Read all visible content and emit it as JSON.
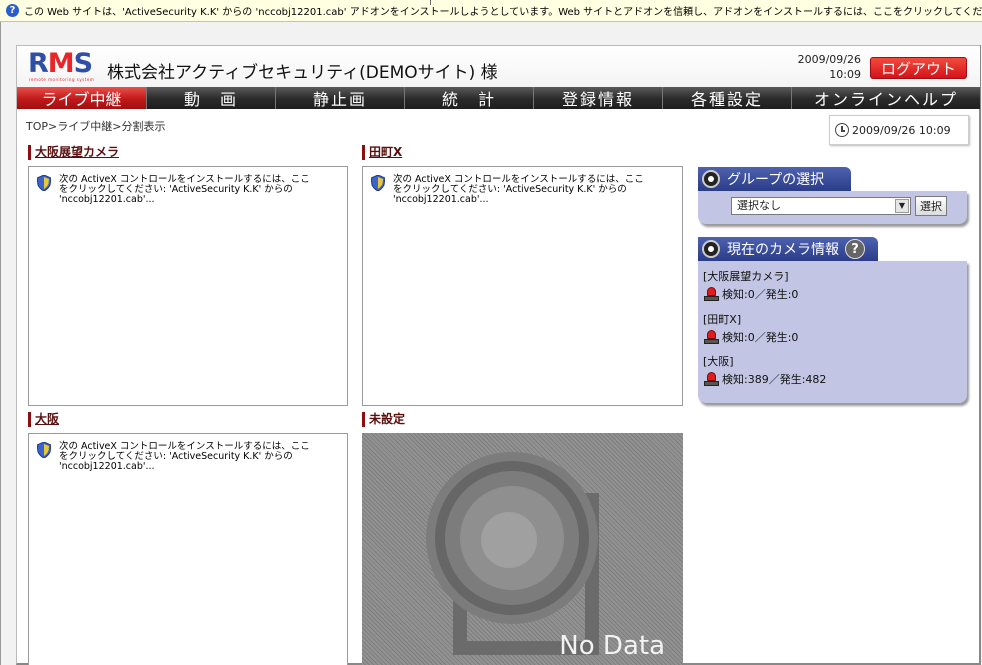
{
  "infobar": {
    "text": "この Web サイトは、'ActiveSecurity K.K' からの 'nccobj12201.cab' アドオンをインストールしようとしています。Web サイトとアドオンを信頼し、アドオンをインストールするには、ここをクリックしてください..."
  },
  "header": {
    "logo": "RMS",
    "logo_subtitle": "remote monitoring system",
    "company": "株式会社アクティブセキュリティ(DEMOサイト) 様",
    "date": "2009/09/26",
    "time": "10:09",
    "logout": "ログアウト"
  },
  "nav": {
    "items": [
      "ライブ中継",
      "動　画",
      "静止画",
      "統　計",
      "登録情報",
      "各種設定",
      "オンラインヘルプ"
    ]
  },
  "breadcrumb": "TOP>ライブ中継>分割表示",
  "clock": "2009/09/26 10:09",
  "cameras": {
    "cam1": {
      "title": "大阪展望カメラ"
    },
    "cam2": {
      "title": "田町X"
    },
    "cam3": {
      "title": "大阪"
    },
    "cam4": {
      "title": "未設定",
      "nodata": "No Data"
    },
    "activex_message": "次の ActiveX コントロールをインストールするには、ここをクリックしてください: 'ActiveSecurity K.K' からの 'nccobj12201.cab'..."
  },
  "group": {
    "title": "グループの選択",
    "selected": "選択なし",
    "button": "選択"
  },
  "camera_info": {
    "title": "現在のカメラ情報",
    "help": "?",
    "entries": [
      {
        "name": "[大阪展望カメラ]",
        "stats": "検知:0／発生:0"
      },
      {
        "name": "[田町X]",
        "stats": "検知:0／発生:0"
      },
      {
        "name": "[大阪]",
        "stats": "検知:389／発生:482"
      }
    ]
  },
  "colors": {
    "accent_red": "#d4121a",
    "nav_dark": "#2a2a2a",
    "panel_blue": "#2b3c88",
    "panel_body": "#c3c5e4",
    "title_bar": "#8b0f0f"
  }
}
